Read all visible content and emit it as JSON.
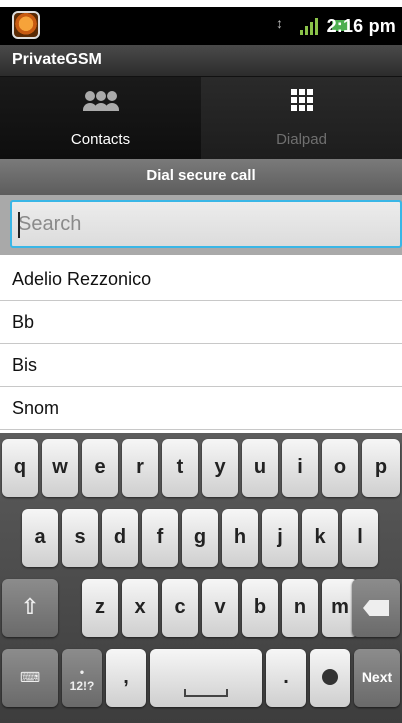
{
  "status": {
    "time": "2:16 pm"
  },
  "app": {
    "title": "PrivateGSM"
  },
  "tabs": [
    {
      "label": "Contacts",
      "icon": "contacts-icon",
      "active": true
    },
    {
      "label": "Dialpad",
      "icon": "dialpad-icon",
      "active": false
    }
  ],
  "dial_bar": {
    "label": "Dial secure call"
  },
  "search": {
    "placeholder": "Search",
    "value": ""
  },
  "contacts": [
    "Adelio Rezzonico",
    "Bb",
    "Bis",
    "Snom"
  ],
  "keyboard": {
    "row1": [
      "q",
      "w",
      "e",
      "r",
      "t",
      "y",
      "u",
      "i",
      "o",
      "p"
    ],
    "row2": [
      "a",
      "s",
      "d",
      "f",
      "g",
      "h",
      "j",
      "k",
      "l"
    ],
    "row3": [
      "z",
      "x",
      "c",
      "v",
      "b",
      "n",
      "m"
    ],
    "symbols_label": "12!?",
    "comma": ",",
    "period": ".",
    "next_label": "Next"
  },
  "colors": {
    "accent": "#39b6e6",
    "status_bar": "#000000",
    "keyboard_bg": "#4a4a4a"
  }
}
